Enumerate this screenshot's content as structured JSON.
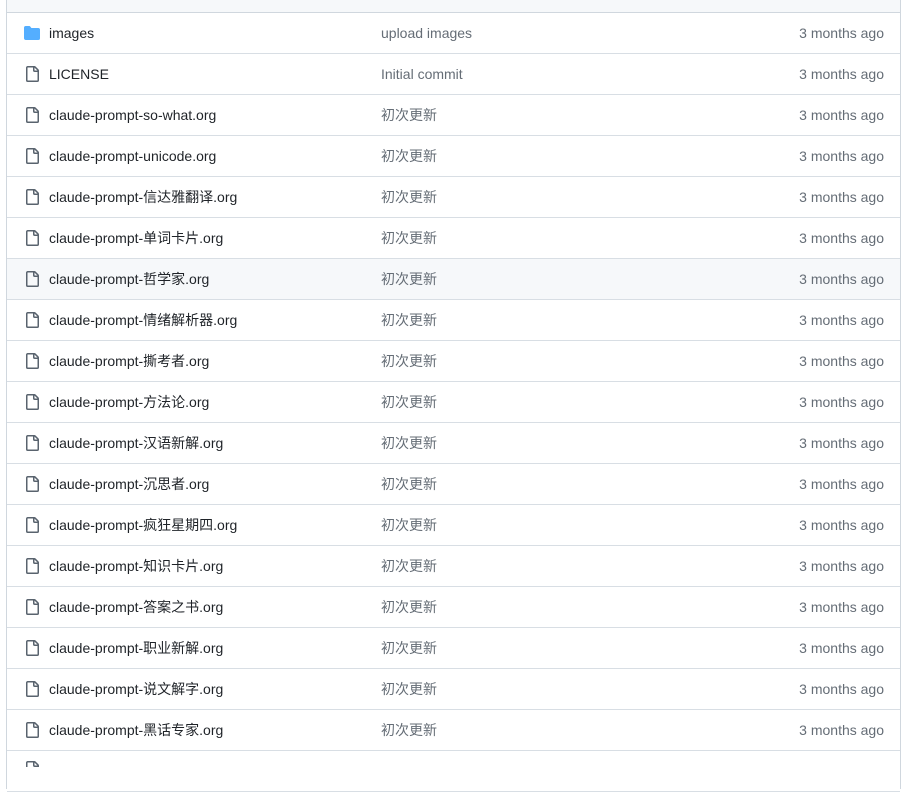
{
  "colors": {
    "folder_icon": "#54aeff",
    "file_icon": "#59636e",
    "text_primary": "#1f2328",
    "text_muted": "#656d76",
    "border": "#d0d7de",
    "row_highlight": "#f6f8fa"
  },
  "files": [
    {
      "type": "folder",
      "icon": "folder-icon",
      "name": "images",
      "commit": "upload images",
      "age": "3 months ago"
    },
    {
      "type": "file",
      "icon": "file-icon",
      "name": "LICENSE",
      "commit": "Initial commit",
      "age": "3 months ago"
    },
    {
      "type": "file",
      "icon": "file-icon",
      "name": "claude-prompt-so-what.org",
      "commit": "初次更新",
      "age": "3 months ago"
    },
    {
      "type": "file",
      "icon": "file-icon",
      "name": "claude-prompt-unicode.org",
      "commit": "初次更新",
      "age": "3 months ago"
    },
    {
      "type": "file",
      "icon": "file-icon",
      "name": "claude-prompt-信达雅翻译.org",
      "commit": "初次更新",
      "age": "3 months ago"
    },
    {
      "type": "file",
      "icon": "file-icon",
      "name": "claude-prompt-单词卡片.org",
      "commit": "初次更新",
      "age": "3 months ago"
    },
    {
      "type": "file",
      "icon": "file-icon",
      "name": "claude-prompt-哲学家.org",
      "commit": "初次更新",
      "age": "3 months ago",
      "highlighted": true
    },
    {
      "type": "file",
      "icon": "file-icon",
      "name": "claude-prompt-情绪解析器.org",
      "commit": "初次更新",
      "age": "3 months ago"
    },
    {
      "type": "file",
      "icon": "file-icon",
      "name": "claude-prompt-撕考者.org",
      "commit": "初次更新",
      "age": "3 months ago"
    },
    {
      "type": "file",
      "icon": "file-icon",
      "name": "claude-prompt-方法论.org",
      "commit": "初次更新",
      "age": "3 months ago"
    },
    {
      "type": "file",
      "icon": "file-icon",
      "name": "claude-prompt-汉语新解.org",
      "commit": "初次更新",
      "age": "3 months ago"
    },
    {
      "type": "file",
      "icon": "file-icon",
      "name": "claude-prompt-沉思者.org",
      "commit": "初次更新",
      "age": "3 months ago"
    },
    {
      "type": "file",
      "icon": "file-icon",
      "name": "claude-prompt-疯狂星期四.org",
      "commit": "初次更新",
      "age": "3 months ago"
    },
    {
      "type": "file",
      "icon": "file-icon",
      "name": "claude-prompt-知识卡片.org",
      "commit": "初次更新",
      "age": "3 months ago"
    },
    {
      "type": "file",
      "icon": "file-icon",
      "name": "claude-prompt-答案之书.org",
      "commit": "初次更新",
      "age": "3 months ago"
    },
    {
      "type": "file",
      "icon": "file-icon",
      "name": "claude-prompt-职业新解.org",
      "commit": "初次更新",
      "age": "3 months ago"
    },
    {
      "type": "file",
      "icon": "file-icon",
      "name": "claude-prompt-说文解字.org",
      "commit": "初次更新",
      "age": "3 months ago"
    },
    {
      "type": "file",
      "icon": "file-icon",
      "name": "claude-prompt-黑话专家.org",
      "commit": "初次更新",
      "age": "3 months ago"
    }
  ],
  "partial_next_row": {
    "type": "file",
    "icon": "file-icon"
  }
}
